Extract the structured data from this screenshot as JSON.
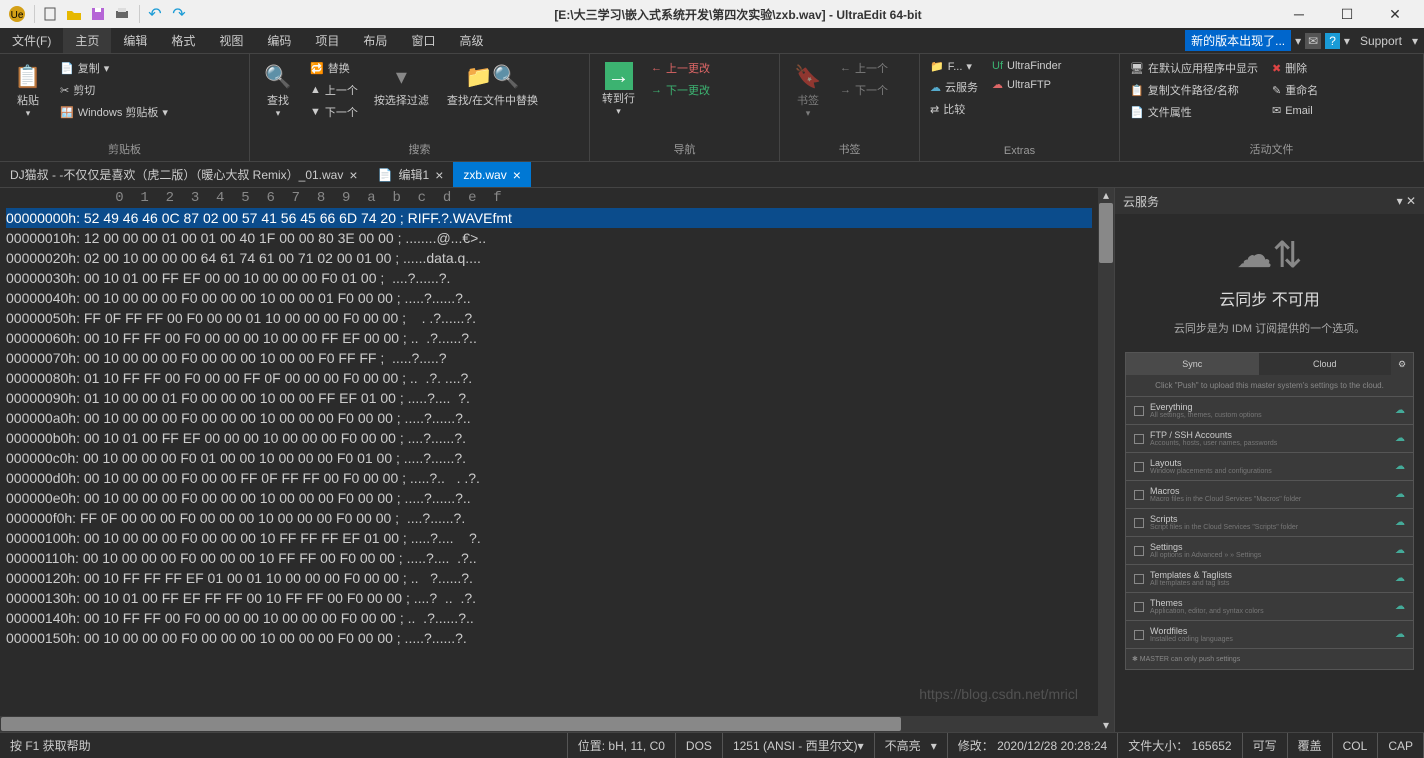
{
  "title": "[E:\\大三学习\\嵌入式系统开发\\第四次实验\\zxb.wav] - UltraEdit 64-bit",
  "menu": [
    "文件(F)",
    "主页",
    "编辑",
    "格式",
    "视图",
    "编码",
    "项目",
    "布局",
    "窗口",
    "高级"
  ],
  "menu_active": 1,
  "new_version": "新的版本出现了...",
  "support": "Support",
  "ribbon": {
    "clipboard": {
      "paste": "粘贴",
      "copy": "复制",
      "cut": "剪切",
      "win": "Windows 剪贴板",
      "label": "剪贴板"
    },
    "search": {
      "find": "查找",
      "replace": "替换",
      "prev": "上一个",
      "next": "下一个",
      "filter": "按选择过滤",
      "findfiles": "查找/在文件中替换",
      "label": "搜索"
    },
    "nav": {
      "goto": "转到行",
      "prevchg": "上一更改",
      "nextchg": "下一更改",
      "label": "导航"
    },
    "bookmark": {
      "bm": "书签",
      "prev": "上一个",
      "next": "下一个",
      "label": "书签"
    },
    "extras": {
      "f": "F...",
      "cloud": "云服务",
      "compare": "比较",
      "uf": "UltraFinder",
      "uftp": "UltraFTP",
      "label": "Extras"
    },
    "active": {
      "show": "在默认应用程序中显示",
      "copypath": "复制文件路径/名称",
      "props": "文件属性",
      "del": "删除",
      "rename": "重命名",
      "email": "Email",
      "label": "活动文件"
    }
  },
  "tabs": [
    {
      "label": "DJ猫叔 - -不仅仅是喜欢（虎二版）（暖心大叔 Remix）_01.wav",
      "active": false,
      "icon": ""
    },
    {
      "label": "编辑1",
      "active": false,
      "icon": "doc"
    },
    {
      "label": "zxb.wav",
      "active": true,
      "icon": ""
    }
  ],
  "hex_ruler": "             0  1  2  3  4  5  6  7  8  9  a  b  c  d  e  f",
  "hex_rows": [
    {
      "sel": true,
      "addr": "00000000h:",
      "b": " 52 49 46 46 0C 87 02 00 57 41 56 45 66 6D 74 20 ",
      "a": "; RIFF.?.WAVEfmt "
    },
    {
      "sel": false,
      "addr": "00000010h:",
      "b": " 12 00 00 00 01 00 01 00 40 1F 00 00 80 3E 00 00 ",
      "a": "; ........@...€>.."
    },
    {
      "sel": false,
      "addr": "00000020h:",
      "b": " 02 00 10 00 00 00 64 61 74 61 00 71 02 00 01 00 ",
      "a": "; ......data.q...."
    },
    {
      "sel": false,
      "addr": "00000030h:",
      "b": " 00 10 01 00 FF EF 00 00 10 00 00 00 F0 01 00 ",
      "a": ";  ....?......?."
    },
    {
      "sel": false,
      "addr": "00000040h:",
      "b": " 00 10 00 00 00 F0 00 00 00 10 00 00 01 F0 00 00 ",
      "a": "; .....?......?.."
    },
    {
      "sel": false,
      "addr": "00000050h:",
      "b": " FF 0F FF FF 00 F0 00 00 01 10 00 00 00 F0 00 00 ",
      "a": ";    . .?......?."
    },
    {
      "sel": false,
      "addr": "00000060h:",
      "b": " 00 10 FF FF 00 F0 00 00 00 10 00 00 FF EF 00 00 ",
      "a": "; ..  .?......?.."
    },
    {
      "sel": false,
      "addr": "00000070h:",
      "b": " 00 10 00 00 00 F0 00 00 00 10 00 00 F0 FF FF ",
      "a": ";  .....?.....?  "
    },
    {
      "sel": false,
      "addr": "00000080h:",
      "b": " 01 10 FF FF 00 F0 00 00 FF 0F 00 00 00 F0 00 00 ",
      "a": "; ..  .?. ....?."
    },
    {
      "sel": false,
      "addr": "00000090h:",
      "b": " 01 10 00 00 01 F0 00 00 00 10 00 00 FF EF 01 00 ",
      "a": "; .....?....  ?."
    },
    {
      "sel": false,
      "addr": "000000a0h:",
      "b": " 00 10 00 00 00 F0 00 00 00 10 00 00 00 F0 00 00 ",
      "a": "; .....?......?.."
    },
    {
      "sel": false,
      "addr": "000000b0h:",
      "b": " 00 10 01 00 FF EF 00 00 00 10 00 00 00 F0 00 00 ",
      "a": "; ....?......?."
    },
    {
      "sel": false,
      "addr": "000000c0h:",
      "b": " 00 10 00 00 00 F0 01 00 00 10 00 00 00 F0 01 00 ",
      "a": "; .....?......?."
    },
    {
      "sel": false,
      "addr": "000000d0h:",
      "b": " 00 10 00 00 00 F0 00 00 FF 0F FF FF 00 F0 00 00 ",
      "a": "; .....?..   . .?."
    },
    {
      "sel": false,
      "addr": "000000e0h:",
      "b": " 00 10 00 00 00 F0 00 00 00 10 00 00 00 F0 00 00 ",
      "a": "; .....?......?.."
    },
    {
      "sel": false,
      "addr": "000000f0h:",
      "b": " FF 0F 00 00 00 F0 00 00 00 10 00 00 00 F0 00 00 ",
      "a": ";  ....?......?."
    },
    {
      "sel": false,
      "addr": "00000100h:",
      "b": " 00 10 00 00 00 F0 00 00 00 10 FF FF FF EF 01 00 ",
      "a": "; .....?....    ?."
    },
    {
      "sel": false,
      "addr": "00000110h:",
      "b": " 00 10 00 00 00 F0 00 00 00 10 FF FF 00 F0 00 00 ",
      "a": "; .....?....  .?.."
    },
    {
      "sel": false,
      "addr": "00000120h:",
      "b": " 00 10 FF FF FF EF 01 00 01 10 00 00 00 F0 00 00 ",
      "a": "; ..   ?......?."
    },
    {
      "sel": false,
      "addr": "00000130h:",
      "b": " 00 10 01 00 FF EF FF FF 00 10 FF FF 00 F0 00 00 ",
      "a": "; ....?  ..  .?."
    },
    {
      "sel": false,
      "addr": "00000140h:",
      "b": " 00 10 FF FF 00 F0 00 00 00 10 00 00 00 F0 00 00 ",
      "a": "; ..  .?......?.."
    },
    {
      "sel": false,
      "addr": "00000150h:",
      "b": " 00 10 00 00 00 F0 00 00 00 10 00 00 00 F0 00 00 ",
      "a": "; .....?......?."
    }
  ],
  "side": {
    "title_panel": "云服务",
    "heading": "云同步 不可用",
    "desc": "云同步是为 IDM 订阅提供的一个选项。",
    "tab_sync": "Sync",
    "tab_cloud": "Cloud",
    "hint": "Click \"Push\" to upload this master system's settings to the cloud.",
    "items": [
      {
        "name": "Everything",
        "desc": "All settings, themes, custom options"
      },
      {
        "name": "FTP / SSH Accounts",
        "desc": "Accounts, hosts, user names, passwords"
      },
      {
        "name": "Layouts",
        "desc": "Window placements and configurations"
      },
      {
        "name": "Macros",
        "desc": "Macro files in the Cloud Services \"Macros\" folder"
      },
      {
        "name": "Scripts",
        "desc": "Script files in the Cloud Services \"Scripts\" folder"
      },
      {
        "name": "Settings",
        "desc": "All options in Advanced » » Settings"
      },
      {
        "name": "Templates & Taglists",
        "desc": "All templates and tag lists"
      },
      {
        "name": "Themes",
        "desc": "Application, editor, and syntax colors"
      },
      {
        "name": "Wordfiles",
        "desc": "Installed coding languages"
      }
    ],
    "footnote": "✱ MASTER can only push settings"
  },
  "status": {
    "help": "按 F1 获取帮助",
    "pos": "位置: bH, 11, C0",
    "dos": "DOS",
    "enc": "1251 (ANSI - 西里尔文)",
    "hl": "不高亮",
    "mod": "修改：",
    "mod_val": "2020/12/28 20:28:24",
    "size": "文件大小：",
    "size_val": "165652",
    "write": "可写",
    "ovr": "覆盖",
    "col": "COL",
    "cap": "CAP"
  },
  "watermark": "https://blog.csdn.net/mricl"
}
